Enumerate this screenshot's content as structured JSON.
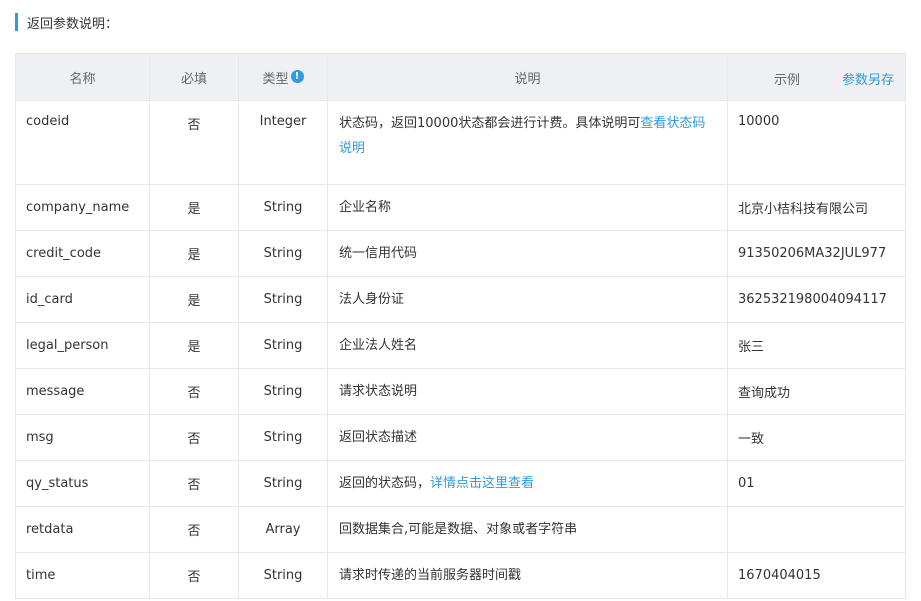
{
  "section_title": "返回参数说明：",
  "headers": {
    "name": "名称",
    "required": "必填",
    "type": "类型",
    "desc": "说明",
    "example": "示例",
    "save_as": "参数另存"
  },
  "rows": [
    {
      "name": "codeid",
      "required": "否",
      "type": "Integer",
      "desc": "状态码，返回10000状态都会进行计费。具体说明可",
      "desc_link": "查看状态码说明",
      "example": "10000"
    },
    {
      "name": "company_name",
      "required": "是",
      "type": "String",
      "desc": "企业名称",
      "desc_link": "",
      "example": "北京小桔科技有限公司"
    },
    {
      "name": "credit_code",
      "required": "是",
      "type": "String",
      "desc": "统一信用代码",
      "desc_link": "",
      "example": "91350206MA32JUL977"
    },
    {
      "name": "id_card",
      "required": "是",
      "type": "String",
      "desc": "法人身份证",
      "desc_link": "",
      "example": "362532198004094117"
    },
    {
      "name": "legal_person",
      "required": "是",
      "type": "String",
      "desc": "企业法人姓名",
      "desc_link": "",
      "example": "张三"
    },
    {
      "name": "message",
      "required": "否",
      "type": "String",
      "desc": "请求状态说明",
      "desc_link": "",
      "example": "查询成功"
    },
    {
      "name": "msg",
      "required": "否",
      "type": "String",
      "desc": "返回状态描述",
      "desc_link": "",
      "example": "一致"
    },
    {
      "name": "qy_status",
      "required": "否",
      "type": "String",
      "desc": "返回的状态码，",
      "desc_link": "详情点击这里查看",
      "example": "01"
    },
    {
      "name": "retdata",
      "required": "否",
      "type": "Array",
      "desc": "回数据集合,可能是数据、对象或者字符串",
      "desc_link": "",
      "example": ""
    },
    {
      "name": "time",
      "required": "否",
      "type": "String",
      "desc": "请求时传递的当前服务器时间戳",
      "desc_link": "",
      "example": "1670404015"
    }
  ]
}
